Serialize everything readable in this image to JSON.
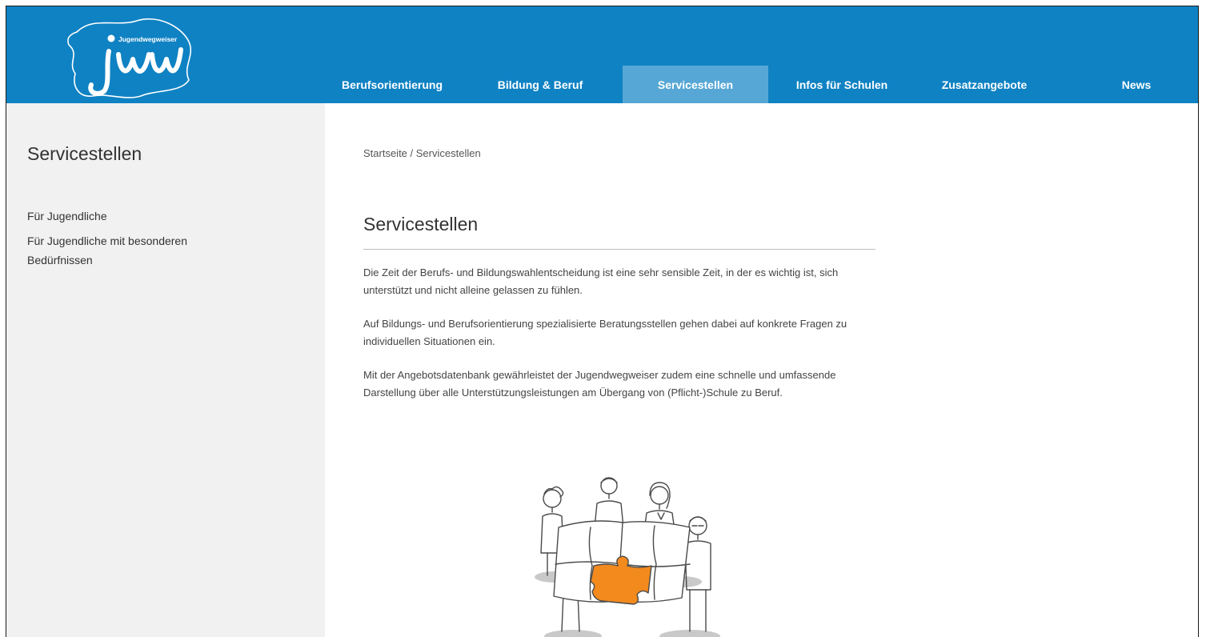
{
  "logo": {
    "text": "Jugendwegweiser",
    "letters": "jww"
  },
  "nav": {
    "items": [
      {
        "label": "Berufsorientierung",
        "active": false
      },
      {
        "label": "Bildung & Beruf",
        "active": false
      },
      {
        "label": "Servicestellen",
        "active": true
      },
      {
        "label": "Infos für Schulen",
        "active": false
      },
      {
        "label": "Zusatzangebote",
        "active": false
      },
      {
        "label": "News",
        "active": false
      }
    ]
  },
  "sidebar": {
    "title": "Servicestellen",
    "items": [
      {
        "label": "Für Jugendliche"
      },
      {
        "label": "Für Jugendliche mit besonderen Bedürfnissen"
      }
    ]
  },
  "main": {
    "breadcrumb": "Startseite / Servicestellen",
    "title": "Servicestellen",
    "paragraphs": [
      "Die Zeit der Berufs- und Bildungswahlentscheidung ist eine sehr sensible Zeit, in der es wichtig ist, sich unterstützt und nicht alleine gelassen zu fühlen.",
      "Auf Bildungs- und Berufsorientierung spezialisierte Beratungsstellen gehen dabei auf konkrete Fragen zu individuellen Situationen ein.",
      "Mit der Angebotsdatenbank gewährleistet der Jugendwegweiser zudem eine schnelle und umfassende Darstellung über alle Unterstützungsleistungen am Übergang von (Pflicht-)Schule zu Beruf."
    ]
  },
  "colors": {
    "header": "#0f82c3",
    "nav_active": "#56a7d5",
    "sidebar_bg": "#f1f1f1",
    "puzzle_accent": "#f28a1e"
  }
}
